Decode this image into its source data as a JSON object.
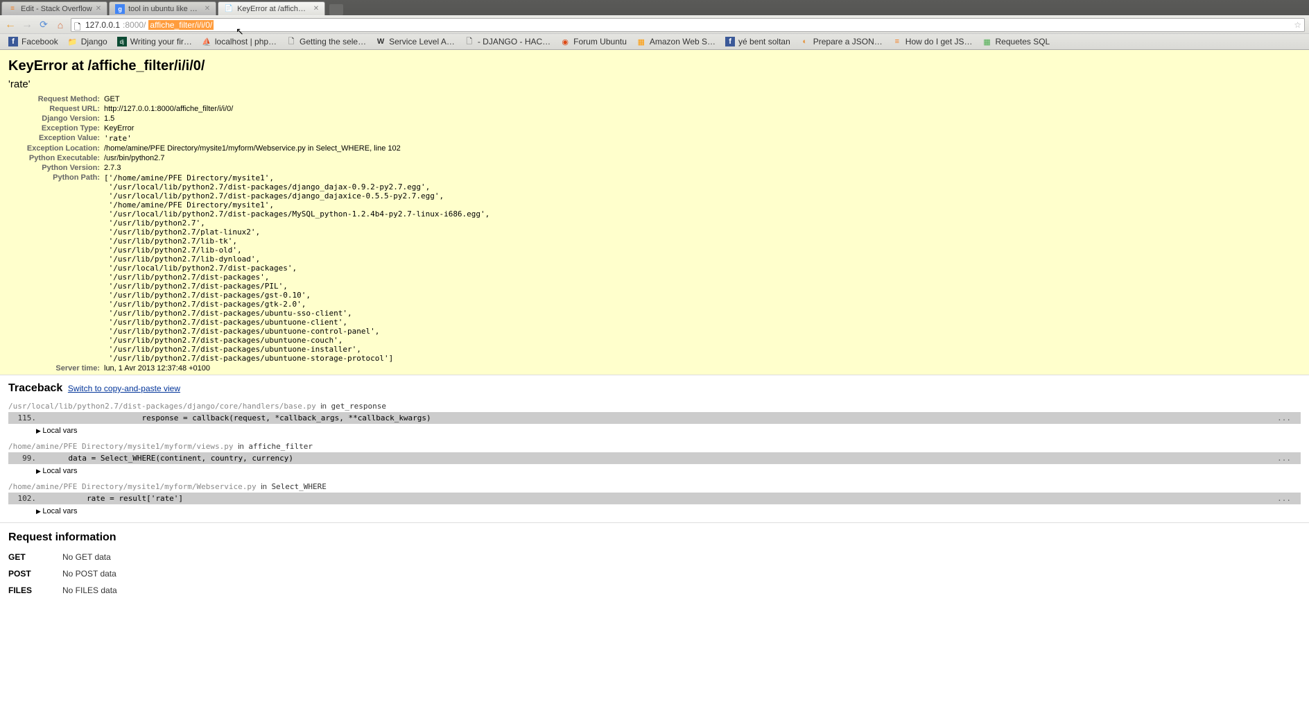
{
  "tabs": [
    {
      "label": "Edit - Stack Overflow",
      "active": false,
      "icon": "so"
    },
    {
      "label": "tool in ubuntu like paint in",
      "active": false,
      "icon": "g"
    },
    {
      "label": "KeyError at /affiche_filte",
      "active": true,
      "icon": "doc"
    }
  ],
  "url": {
    "host": "127.0.0.1",
    "port": ":8000/",
    "path": "affiche_filter/i/i/0/"
  },
  "bookmarks": [
    {
      "label": "Facebook",
      "icon": "f"
    },
    {
      "label": "Django",
      "icon": "dj"
    },
    {
      "label": "Writing your fir…",
      "icon": "dj2"
    },
    {
      "label": "localhost | php…",
      "icon": "php"
    },
    {
      "label": "Getting the sele…",
      "icon": ""
    },
    {
      "label": "Service Level A…",
      "icon": "w"
    },
    {
      "label": "- DJANGO - HAC…",
      "icon": "doc"
    },
    {
      "label": "Forum Ubuntu",
      "icon": "ub"
    },
    {
      "label": "Amazon Web S…",
      "icon": "aws"
    },
    {
      "label": "yé bent soltan",
      "icon": "f"
    },
    {
      "label": "Prepare a JSON…",
      "icon": "or"
    },
    {
      "label": "How do I get JS…",
      "icon": "so"
    },
    {
      "label": "Requetes SQL",
      "icon": "sql"
    }
  ],
  "error": {
    "title": "KeyError at /affiche_filter/i/i/0/",
    "value": "'rate'",
    "rows": {
      "request_method": {
        "label": "Request Method:",
        "value": "GET"
      },
      "request_url": {
        "label": "Request URL:",
        "value": "http://127.0.0.1:8000/affiche_filter/i/i/0/"
      },
      "django_version": {
        "label": "Django Version:",
        "value": "1.5"
      },
      "exception_type": {
        "label": "Exception Type:",
        "value": "KeyError"
      },
      "exception_value": {
        "label": "Exception Value:",
        "value": "'rate'"
      },
      "exception_location": {
        "label": "Exception Location:",
        "value": "/home/amine/PFE Directory/mysite1/myform/Webservice.py in Select_WHERE, line 102"
      },
      "python_executable": {
        "label": "Python Executable:",
        "value": "/usr/bin/python2.7"
      },
      "python_version": {
        "label": "Python Version:",
        "value": "2.7.3"
      },
      "python_path": {
        "label": "Python Path:",
        "value": "['/home/amine/PFE Directory/mysite1',\n '/usr/local/lib/python2.7/dist-packages/django_dajax-0.9.2-py2.7.egg',\n '/usr/local/lib/python2.7/dist-packages/django_dajaxice-0.5.5-py2.7.egg',\n '/home/amine/PFE Directory/mysite1',\n '/usr/local/lib/python2.7/dist-packages/MySQL_python-1.2.4b4-py2.7-linux-i686.egg',\n '/usr/lib/python2.7',\n '/usr/lib/python2.7/plat-linux2',\n '/usr/lib/python2.7/lib-tk',\n '/usr/lib/python2.7/lib-old',\n '/usr/lib/python2.7/lib-dynload',\n '/usr/local/lib/python2.7/dist-packages',\n '/usr/lib/python2.7/dist-packages',\n '/usr/lib/python2.7/dist-packages/PIL',\n '/usr/lib/python2.7/dist-packages/gst-0.10',\n '/usr/lib/python2.7/dist-packages/gtk-2.0',\n '/usr/lib/python2.7/dist-packages/ubuntu-sso-client',\n '/usr/lib/python2.7/dist-packages/ubuntuone-client',\n '/usr/lib/python2.7/dist-packages/ubuntuone-control-panel',\n '/usr/lib/python2.7/dist-packages/ubuntuone-couch',\n '/usr/lib/python2.7/dist-packages/ubuntuone-installer',\n '/usr/lib/python2.7/dist-packages/ubuntuone-storage-protocol']"
      },
      "server_time": {
        "label": "Server time:",
        "value": "lun, 1 Avr 2013 12:37:48 +0100"
      }
    }
  },
  "traceback": {
    "heading": "Traceback",
    "switch": "Switch to copy-and-paste view",
    "local_vars": "Local vars",
    "frames": [
      {
        "path": "/usr/local/lib/python2.7/dist-packages/django/core/handlers/base.py",
        "fn": "get_response",
        "lineno": "115.",
        "code": "                    response = callback(request, *callback_args, **callback_kwargs)"
      },
      {
        "path": "/home/amine/PFE Directory/mysite1/myform/views.py",
        "fn": "affiche_filter",
        "lineno": "99.",
        "code": "    data = Select_WHERE(continent, country, currency)"
      },
      {
        "path": "/home/amine/PFE Directory/mysite1/myform/Webservice.py",
        "fn": "Select_WHERE",
        "lineno": "102.",
        "code": "        rate = result['rate']"
      }
    ]
  },
  "request_info": {
    "heading": "Request information",
    "rows": [
      {
        "key": "GET",
        "val": "No GET data"
      },
      {
        "key": "POST",
        "val": "No POST data"
      },
      {
        "key": "FILES",
        "val": "No FILES data"
      }
    ]
  }
}
